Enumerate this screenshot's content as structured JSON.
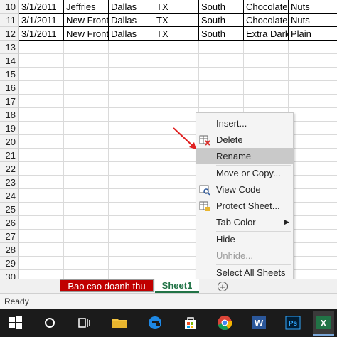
{
  "rows": [
    {
      "num": "10",
      "cells": [
        "3/1/2011",
        "Jeffries",
        "Dallas",
        "TX",
        "South",
        "Chocolate",
        "Nuts"
      ]
    },
    {
      "num": "11",
      "cells": [
        "3/1/2011",
        "New Front",
        "Dallas",
        "TX",
        "South",
        "Chocolate",
        "Nuts"
      ]
    },
    {
      "num": "12",
      "cells": [
        "3/1/2011",
        "New Front",
        "Dallas",
        "TX",
        "South",
        "Extra Dark",
        "Plain"
      ]
    },
    {
      "num": "13",
      "cells": [
        "",
        "",
        "",
        "",
        "",
        "",
        ""
      ]
    },
    {
      "num": "14",
      "cells": [
        "",
        "",
        "",
        "",
        "",
        "",
        ""
      ]
    },
    {
      "num": "15",
      "cells": [
        "",
        "",
        "",
        "",
        "",
        "",
        ""
      ]
    },
    {
      "num": "16",
      "cells": [
        "",
        "",
        "",
        "",
        "",
        "",
        ""
      ]
    },
    {
      "num": "17",
      "cells": [
        "",
        "",
        "",
        "",
        "",
        "",
        ""
      ]
    },
    {
      "num": "18",
      "cells": [
        "",
        "",
        "",
        "",
        "",
        "",
        ""
      ]
    },
    {
      "num": "19",
      "cells": [
        "",
        "",
        "",
        "",
        "",
        "",
        ""
      ]
    },
    {
      "num": "20",
      "cells": [
        "",
        "",
        "",
        "",
        "",
        "",
        ""
      ]
    },
    {
      "num": "21",
      "cells": [
        "",
        "",
        "",
        "",
        "",
        "",
        ""
      ]
    },
    {
      "num": "22",
      "cells": [
        "",
        "",
        "",
        "",
        "",
        "",
        ""
      ]
    },
    {
      "num": "23",
      "cells": [
        "",
        "",
        "",
        "",
        "",
        "",
        ""
      ]
    },
    {
      "num": "24",
      "cells": [
        "",
        "",
        "",
        "",
        "",
        "",
        ""
      ]
    },
    {
      "num": "25",
      "cells": [
        "",
        "",
        "",
        "",
        "",
        "",
        ""
      ]
    },
    {
      "num": "26",
      "cells": [
        "",
        "",
        "",
        "",
        "",
        "",
        ""
      ]
    },
    {
      "num": "27",
      "cells": [
        "",
        "",
        "",
        "",
        "",
        "",
        ""
      ]
    },
    {
      "num": "28",
      "cells": [
        "",
        "",
        "",
        "",
        "",
        "",
        ""
      ]
    },
    {
      "num": "29",
      "cells": [
        "",
        "",
        "",
        "",
        "",
        "",
        ""
      ]
    },
    {
      "num": "30",
      "cells": [
        "",
        "",
        "",
        "",
        "",
        "",
        ""
      ]
    }
  ],
  "tabs": {
    "sheet_a": "Bao cao doanh thu",
    "sheet_b": "Sheet1",
    "add": "+"
  },
  "status": "Ready",
  "context_menu": {
    "items": [
      {
        "label": "Insert...",
        "enabled": true,
        "icon": null
      },
      {
        "label": "Delete",
        "enabled": true,
        "icon": "delete-sheet-icon"
      },
      {
        "label": "Rename",
        "enabled": true,
        "icon": null,
        "highlighted": true
      },
      {
        "label": "Move or Copy...",
        "enabled": true,
        "icon": null
      },
      {
        "label": "View Code",
        "enabled": true,
        "icon": "view-code-icon"
      },
      {
        "label": "Protect Sheet...",
        "enabled": true,
        "icon": "protect-sheet-icon"
      },
      {
        "label": "Tab Color",
        "enabled": true,
        "icon": null,
        "submenu": true
      },
      {
        "label": "Hide",
        "enabled": true,
        "icon": null
      },
      {
        "label": "Unhide...",
        "enabled": false,
        "icon": null
      },
      {
        "label": "Select All Sheets",
        "enabled": true,
        "icon": null
      }
    ]
  },
  "taskbar": [
    "windows-start-icon",
    "search-icon",
    "task-view-icon",
    "file-explorer-icon",
    "edge-icon",
    "store-icon",
    "chrome-icon",
    "word-icon",
    "photoshop-icon",
    "excel-icon"
  ],
  "colors": {
    "sheet_a_tab": "#c00000",
    "active_tab_text": "#217346",
    "annotation_arrow": "#e02020",
    "taskbar": "#1b1b1b"
  }
}
